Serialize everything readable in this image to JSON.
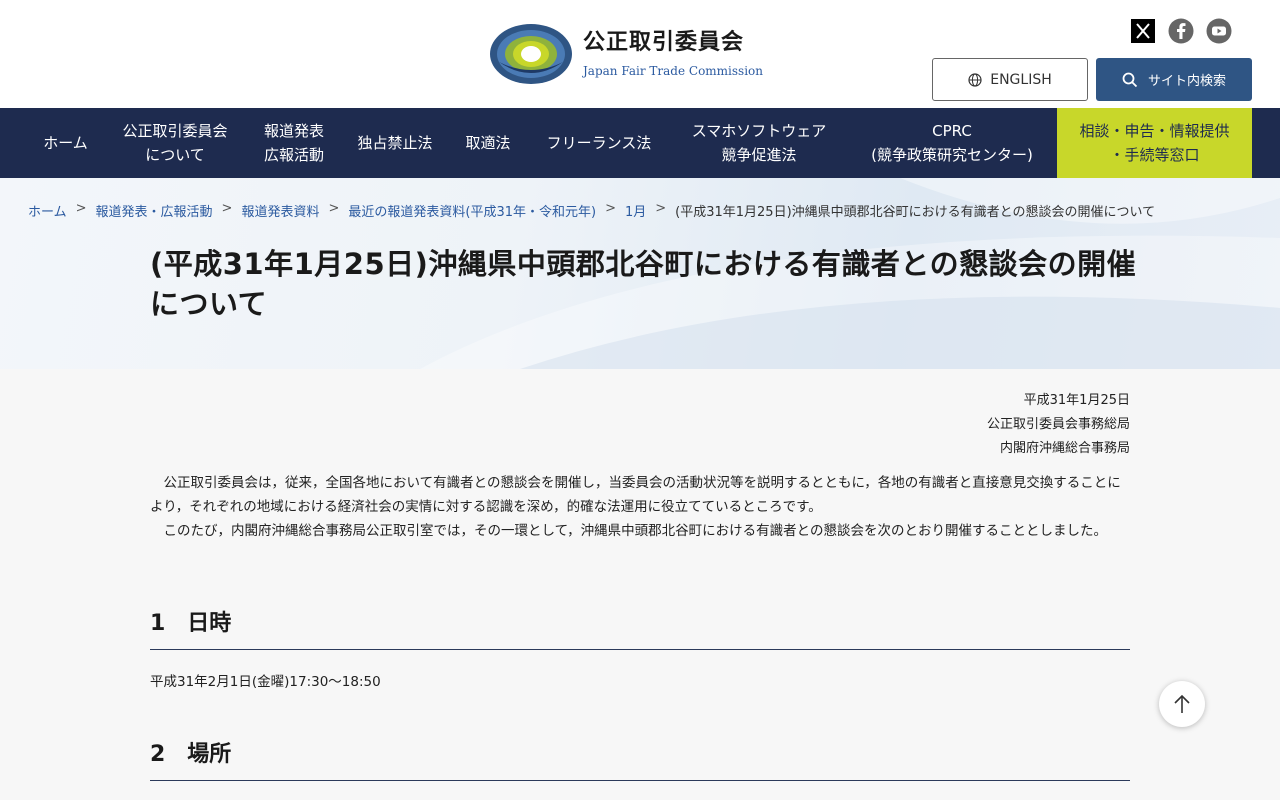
{
  "header": {
    "logo_ja": "公正取引委員会",
    "logo_en": "Japan Fair Trade Commission",
    "english_button": "ENGLISH",
    "search_button": "サイト内検索",
    "social_icons": [
      "x-icon",
      "facebook-icon",
      "youtube-icon"
    ]
  },
  "nav": {
    "items": [
      {
        "line1": "ホーム",
        "line2": ""
      },
      {
        "line1": "公正取引委員会",
        "line2": "について"
      },
      {
        "line1": "報道発表",
        "line2": "広報活動"
      },
      {
        "line1": "独占禁止法",
        "line2": ""
      },
      {
        "line1": "取適法",
        "line2": ""
      },
      {
        "line1": "フリーランス法",
        "line2": ""
      },
      {
        "line1": "スマホソフトウェア",
        "line2": "競争促進法"
      },
      {
        "line1": "CPRC",
        "line2": "(競争政策研究センター)"
      }
    ],
    "consult": {
      "line1": "相談・申告・情報提供",
      "line2": "・手続等窓口"
    }
  },
  "breadcrumb": [
    "ホーム",
    "報道発表・広報活動",
    "報道発表資料",
    "最近の報道発表資料(平成31年・令和元年)",
    "1月",
    "(平成31年1月25日)沖縄県中頭郡北谷町における有識者との懇談会の開催について"
  ],
  "title": "(平成31年1月25日)沖縄県中頭郡北谷町における有識者との懇談会の開催について",
  "meta": {
    "date": "平成31年1月25日",
    "org1": "公正取引委員会事務総局",
    "org2": "内閣府沖縄総合事務局"
  },
  "body": {
    "p1": "公正取引委員会は，従来，全国各地において有識者との懇談会を開催し，当委員会の活動状況等を説明するとともに，各地の有識者と直接意見交換することにより，それぞれの地域における経済社会の実情に対する認識を深め，的確な法運用に役立てているところです。",
    "p2": "このたび，内閣府沖縄総合事務局公正取引室では，その一環として，沖縄県中頭郡北谷町における有識者との懇談会を次のとおり開催することとしました。"
  },
  "sections": [
    {
      "heading": "1　日時",
      "text": "平成31年2月1日(金曜)17:30～18:50"
    },
    {
      "heading": "2　場所",
      "text": ""
    }
  ],
  "colors": {
    "nav_bg": "#1e2b4f",
    "consult_bg": "#c8d72a",
    "search_bg": "#2f5584",
    "link": "#2b5aa0"
  }
}
